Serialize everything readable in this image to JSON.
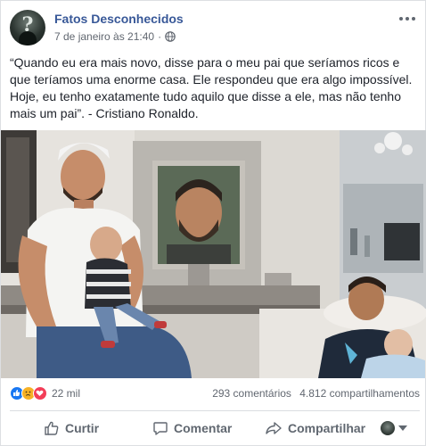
{
  "post": {
    "page_name": "Fatos Desconhecidos",
    "timestamp": "7 de janeiro às 21:40",
    "separator": "·",
    "audience_icon": "globe-icon",
    "text": "“Quando eu era mais novo, disse para o meu pai que seríamos ricos e que teríamos uma enorme casa. Ele respondeu que era algo impossível. Hoje, eu tenho exatamente tudo aquilo que disse a ele, mas não tenho mais um pai”. - Cristiano Ronaldo."
  },
  "reactions": {
    "icons": [
      "like-icon",
      "sad-icon",
      "love-icon"
    ],
    "count": "22 mil"
  },
  "counts": {
    "comments": "293 comentários",
    "shares": "4.812 compartilhamentos"
  },
  "actions": {
    "like_label": "Curtir",
    "comment_label": "Comentar",
    "share_label": "Compartilhar"
  },
  "colors": {
    "link": "#385898",
    "secondary_text": "#616770",
    "like_blue": "#1877f2",
    "love_red": "#f33e58",
    "sad_yellow": "#f7b125"
  }
}
